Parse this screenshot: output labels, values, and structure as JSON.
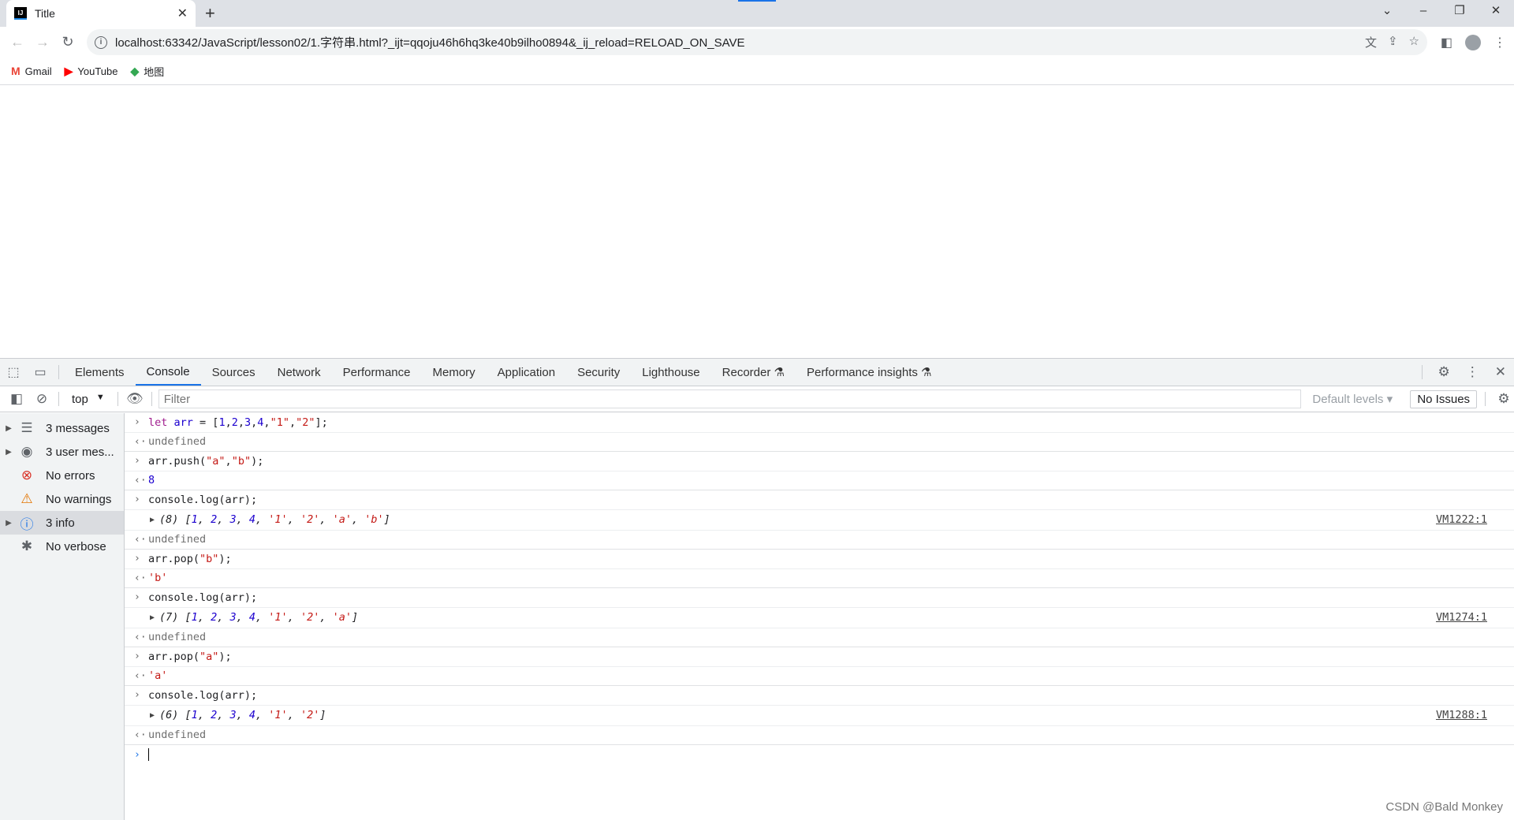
{
  "browser": {
    "tab_title": "Title",
    "favicon": "IJ",
    "url": "localhost:63342/JavaScript/lesson02/1.字符串.html?_ijt=qqoju46h6hq3ke40b9ilho0894&_ij_reload=RELOAD_ON_SAVE",
    "bookmarks": [
      {
        "label": "Gmail",
        "icon": "M",
        "color": "#ea4335"
      },
      {
        "label": "YouTube",
        "icon": "▶",
        "color": "#ff0000"
      },
      {
        "label": "地图",
        "icon": "◆",
        "color": "#34a853"
      }
    ]
  },
  "devtools": {
    "tabs": [
      "Elements",
      "Console",
      "Sources",
      "Network",
      "Performance",
      "Memory",
      "Application",
      "Security",
      "Lighthouse",
      "Recorder ⚗",
      "Performance insights ⚗"
    ],
    "active_tab": "Console",
    "context": "top",
    "filter_placeholder": "Filter",
    "levels": "Default levels ▾",
    "issues": "No Issues",
    "sidebar": [
      {
        "label": "3 messages",
        "icon": "☰",
        "expand": true,
        "color": "#5f6368"
      },
      {
        "label": "3 user mes...",
        "icon": "◉",
        "expand": true,
        "color": "#5f6368"
      },
      {
        "label": "No errors",
        "icon": "⊗",
        "expand": false,
        "color": "#d93025"
      },
      {
        "label": "No warnings",
        "icon": "⚠",
        "expand": false,
        "color": "#e37400"
      },
      {
        "label": "3 info",
        "icon": "ⓘ",
        "expand": true,
        "color": "#1a73e8",
        "selected": true
      },
      {
        "label": "No verbose",
        "icon": "✱",
        "expand": false,
        "color": "#5f6368"
      }
    ],
    "entries": [
      {
        "type": "in",
        "tokens": [
          [
            "let",
            "kw"
          ],
          [
            " ",
            ""
          ],
          [
            "arr",
            "vr"
          ],
          [
            " = [",
            ""
          ],
          [
            "1",
            "num"
          ],
          [
            ",",
            ""
          ],
          [
            "2",
            "num"
          ],
          [
            ",",
            ""
          ],
          [
            "3",
            "num"
          ],
          [
            ",",
            ""
          ],
          [
            "4",
            "num"
          ],
          [
            ",",
            ""
          ],
          [
            "\"1\"",
            "str"
          ],
          [
            ",",
            ""
          ],
          [
            "\"2\"",
            "str"
          ],
          [
            "];",
            ""
          ]
        ]
      },
      {
        "type": "out",
        "tokens": [
          [
            "undefined",
            "gray"
          ]
        ]
      },
      {
        "type": "in",
        "tokens": [
          [
            "arr.push(",
            ""
          ],
          [
            "\"a\"",
            "str"
          ],
          [
            ",",
            ""
          ],
          [
            "\"b\"",
            "str"
          ],
          [
            ");",
            ""
          ]
        ]
      },
      {
        "type": "out",
        "tokens": [
          [
            "8",
            "num"
          ]
        ]
      },
      {
        "type": "in",
        "tokens": [
          [
            "console.log(arr);",
            ""
          ]
        ]
      },
      {
        "type": "log",
        "src": "VM1222:1",
        "tokens": [
          [
            "(8) [",
            ""
          ],
          [
            "1",
            "num"
          ],
          [
            ", ",
            ""
          ],
          [
            "2",
            "num"
          ],
          [
            ", ",
            ""
          ],
          [
            "3",
            "num"
          ],
          [
            ", ",
            ""
          ],
          [
            "4",
            "num"
          ],
          [
            ", ",
            ""
          ],
          [
            "'1'",
            "str"
          ],
          [
            ", ",
            ""
          ],
          [
            "'2'",
            "str"
          ],
          [
            ", ",
            ""
          ],
          [
            "'a'",
            "str"
          ],
          [
            ", ",
            ""
          ],
          [
            "'b'",
            "str"
          ],
          [
            "]",
            ""
          ]
        ]
      },
      {
        "type": "out",
        "tokens": [
          [
            "undefined",
            "gray"
          ]
        ]
      },
      {
        "type": "in",
        "tokens": [
          [
            "arr.pop(",
            ""
          ],
          [
            "\"b\"",
            "str"
          ],
          [
            ");",
            ""
          ]
        ]
      },
      {
        "type": "out",
        "tokens": [
          [
            "'b'",
            "str"
          ]
        ]
      },
      {
        "type": "in",
        "tokens": [
          [
            "console.log(arr);",
            ""
          ]
        ]
      },
      {
        "type": "log",
        "src": "VM1274:1",
        "tokens": [
          [
            "(7) [",
            ""
          ],
          [
            "1",
            "num"
          ],
          [
            ", ",
            ""
          ],
          [
            "2",
            "num"
          ],
          [
            ", ",
            ""
          ],
          [
            "3",
            "num"
          ],
          [
            ", ",
            ""
          ],
          [
            "4",
            "num"
          ],
          [
            ", ",
            ""
          ],
          [
            "'1'",
            "str"
          ],
          [
            ", ",
            ""
          ],
          [
            "'2'",
            "str"
          ],
          [
            ", ",
            ""
          ],
          [
            "'a'",
            "str"
          ],
          [
            "]",
            ""
          ]
        ]
      },
      {
        "type": "out",
        "tokens": [
          [
            "undefined",
            "gray"
          ]
        ]
      },
      {
        "type": "in",
        "tokens": [
          [
            "arr.pop(",
            ""
          ],
          [
            "\"a\"",
            "str"
          ],
          [
            ");",
            ""
          ]
        ]
      },
      {
        "type": "out",
        "tokens": [
          [
            "'a'",
            "str"
          ]
        ]
      },
      {
        "type": "in",
        "tokens": [
          [
            "console.log(arr);",
            ""
          ]
        ]
      },
      {
        "type": "log",
        "src": "VM1288:1",
        "tokens": [
          [
            "(6) [",
            ""
          ],
          [
            "1",
            "num"
          ],
          [
            ", ",
            ""
          ],
          [
            "2",
            "num"
          ],
          [
            ", ",
            ""
          ],
          [
            "3",
            "num"
          ],
          [
            ", ",
            ""
          ],
          [
            "4",
            "num"
          ],
          [
            ", ",
            ""
          ],
          [
            "'1'",
            "str"
          ],
          [
            ", ",
            ""
          ],
          [
            "'2'",
            "str"
          ],
          [
            "]",
            ""
          ]
        ]
      },
      {
        "type": "out",
        "tokens": [
          [
            "undefined",
            "gray"
          ]
        ]
      }
    ]
  },
  "watermark": "CSDN @Bald Monkey"
}
